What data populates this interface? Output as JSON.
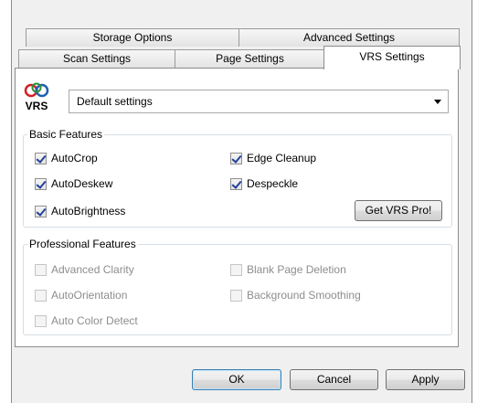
{
  "tabs": {
    "row_top": [
      {
        "label": "Storage Options"
      },
      {
        "label": "Advanced Settings"
      }
    ],
    "row_bottom": [
      {
        "label": "Scan Settings"
      },
      {
        "label": "Page Settings"
      },
      {
        "label": "VRS Settings",
        "active": true
      }
    ]
  },
  "vrs": {
    "logo_text": "VRS",
    "profile_value": "Default settings"
  },
  "basic": {
    "title": "Basic Features",
    "items": [
      {
        "label": "AutoCrop",
        "checked": true
      },
      {
        "label": "Edge Cleanup",
        "checked": true
      },
      {
        "label": "AutoDeskew",
        "checked": true
      },
      {
        "label": "Despeckle",
        "checked": true
      },
      {
        "label": "AutoBrightness",
        "checked": true
      }
    ],
    "pro_button": "Get VRS Pro!"
  },
  "professional": {
    "title": "Professional Features",
    "items": [
      {
        "label": "Advanced Clarity",
        "checked": false,
        "enabled": false
      },
      {
        "label": "Blank Page Deletion",
        "checked": false,
        "enabled": false
      },
      {
        "label": "AutoOrientation",
        "checked": false,
        "enabled": false
      },
      {
        "label": "Background Smoothing",
        "checked": false,
        "enabled": false
      },
      {
        "label": "Auto Color Detect",
        "checked": false,
        "enabled": false
      }
    ]
  },
  "buttons": {
    "ok": "OK",
    "cancel": "Cancel",
    "apply": "Apply"
  },
  "colors": {
    "dialog_bg": "#f0f0f0",
    "check_color": "#21409a",
    "disabled_text": "#8d8d8d"
  }
}
